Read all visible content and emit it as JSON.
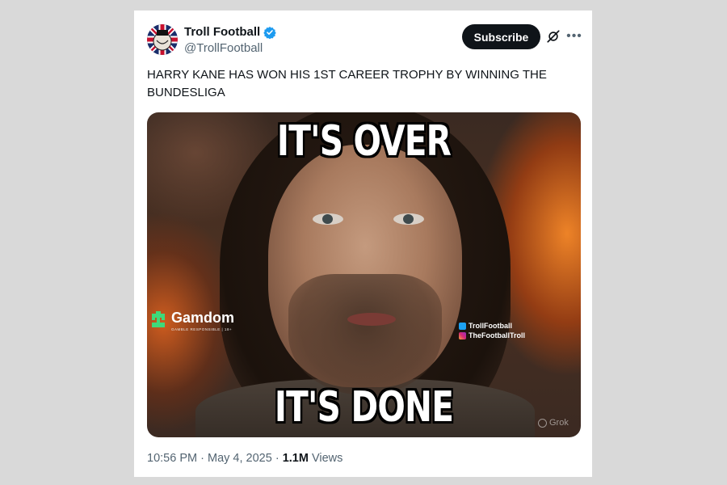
{
  "account": {
    "display_name": "Troll Football",
    "handle": "@TrollFootball",
    "verified": true,
    "verified_color": "#1d9bf0"
  },
  "actions": {
    "subscribe_label": "Subscribe",
    "grok_icon": "grok-icon",
    "more_icon": "more-icon"
  },
  "tweet": {
    "text": "HARRY KANE HAS WON HIS 1ST CAREER TROPHY BY WINNING THE BUNDESLIGA"
  },
  "media": {
    "top_caption": "IT'S OVER",
    "bottom_caption": "IT'S DONE",
    "sponsor_name": "Gamdom",
    "sponsor_tagline": "GAMBLE RESPONSIBLE | 18+",
    "social_twitter": "TrollFootball",
    "social_instagram": "TheFootballTroll",
    "watermark": "Grok"
  },
  "meta": {
    "time": "10:56 PM",
    "separator": "·",
    "date": "May 4, 2025",
    "views_count": "1.1M",
    "views_label": "Views"
  },
  "colors": {
    "subscribe_bg": "#0f1419",
    "secondary_text": "#536471",
    "primary_text": "#0f1419"
  }
}
